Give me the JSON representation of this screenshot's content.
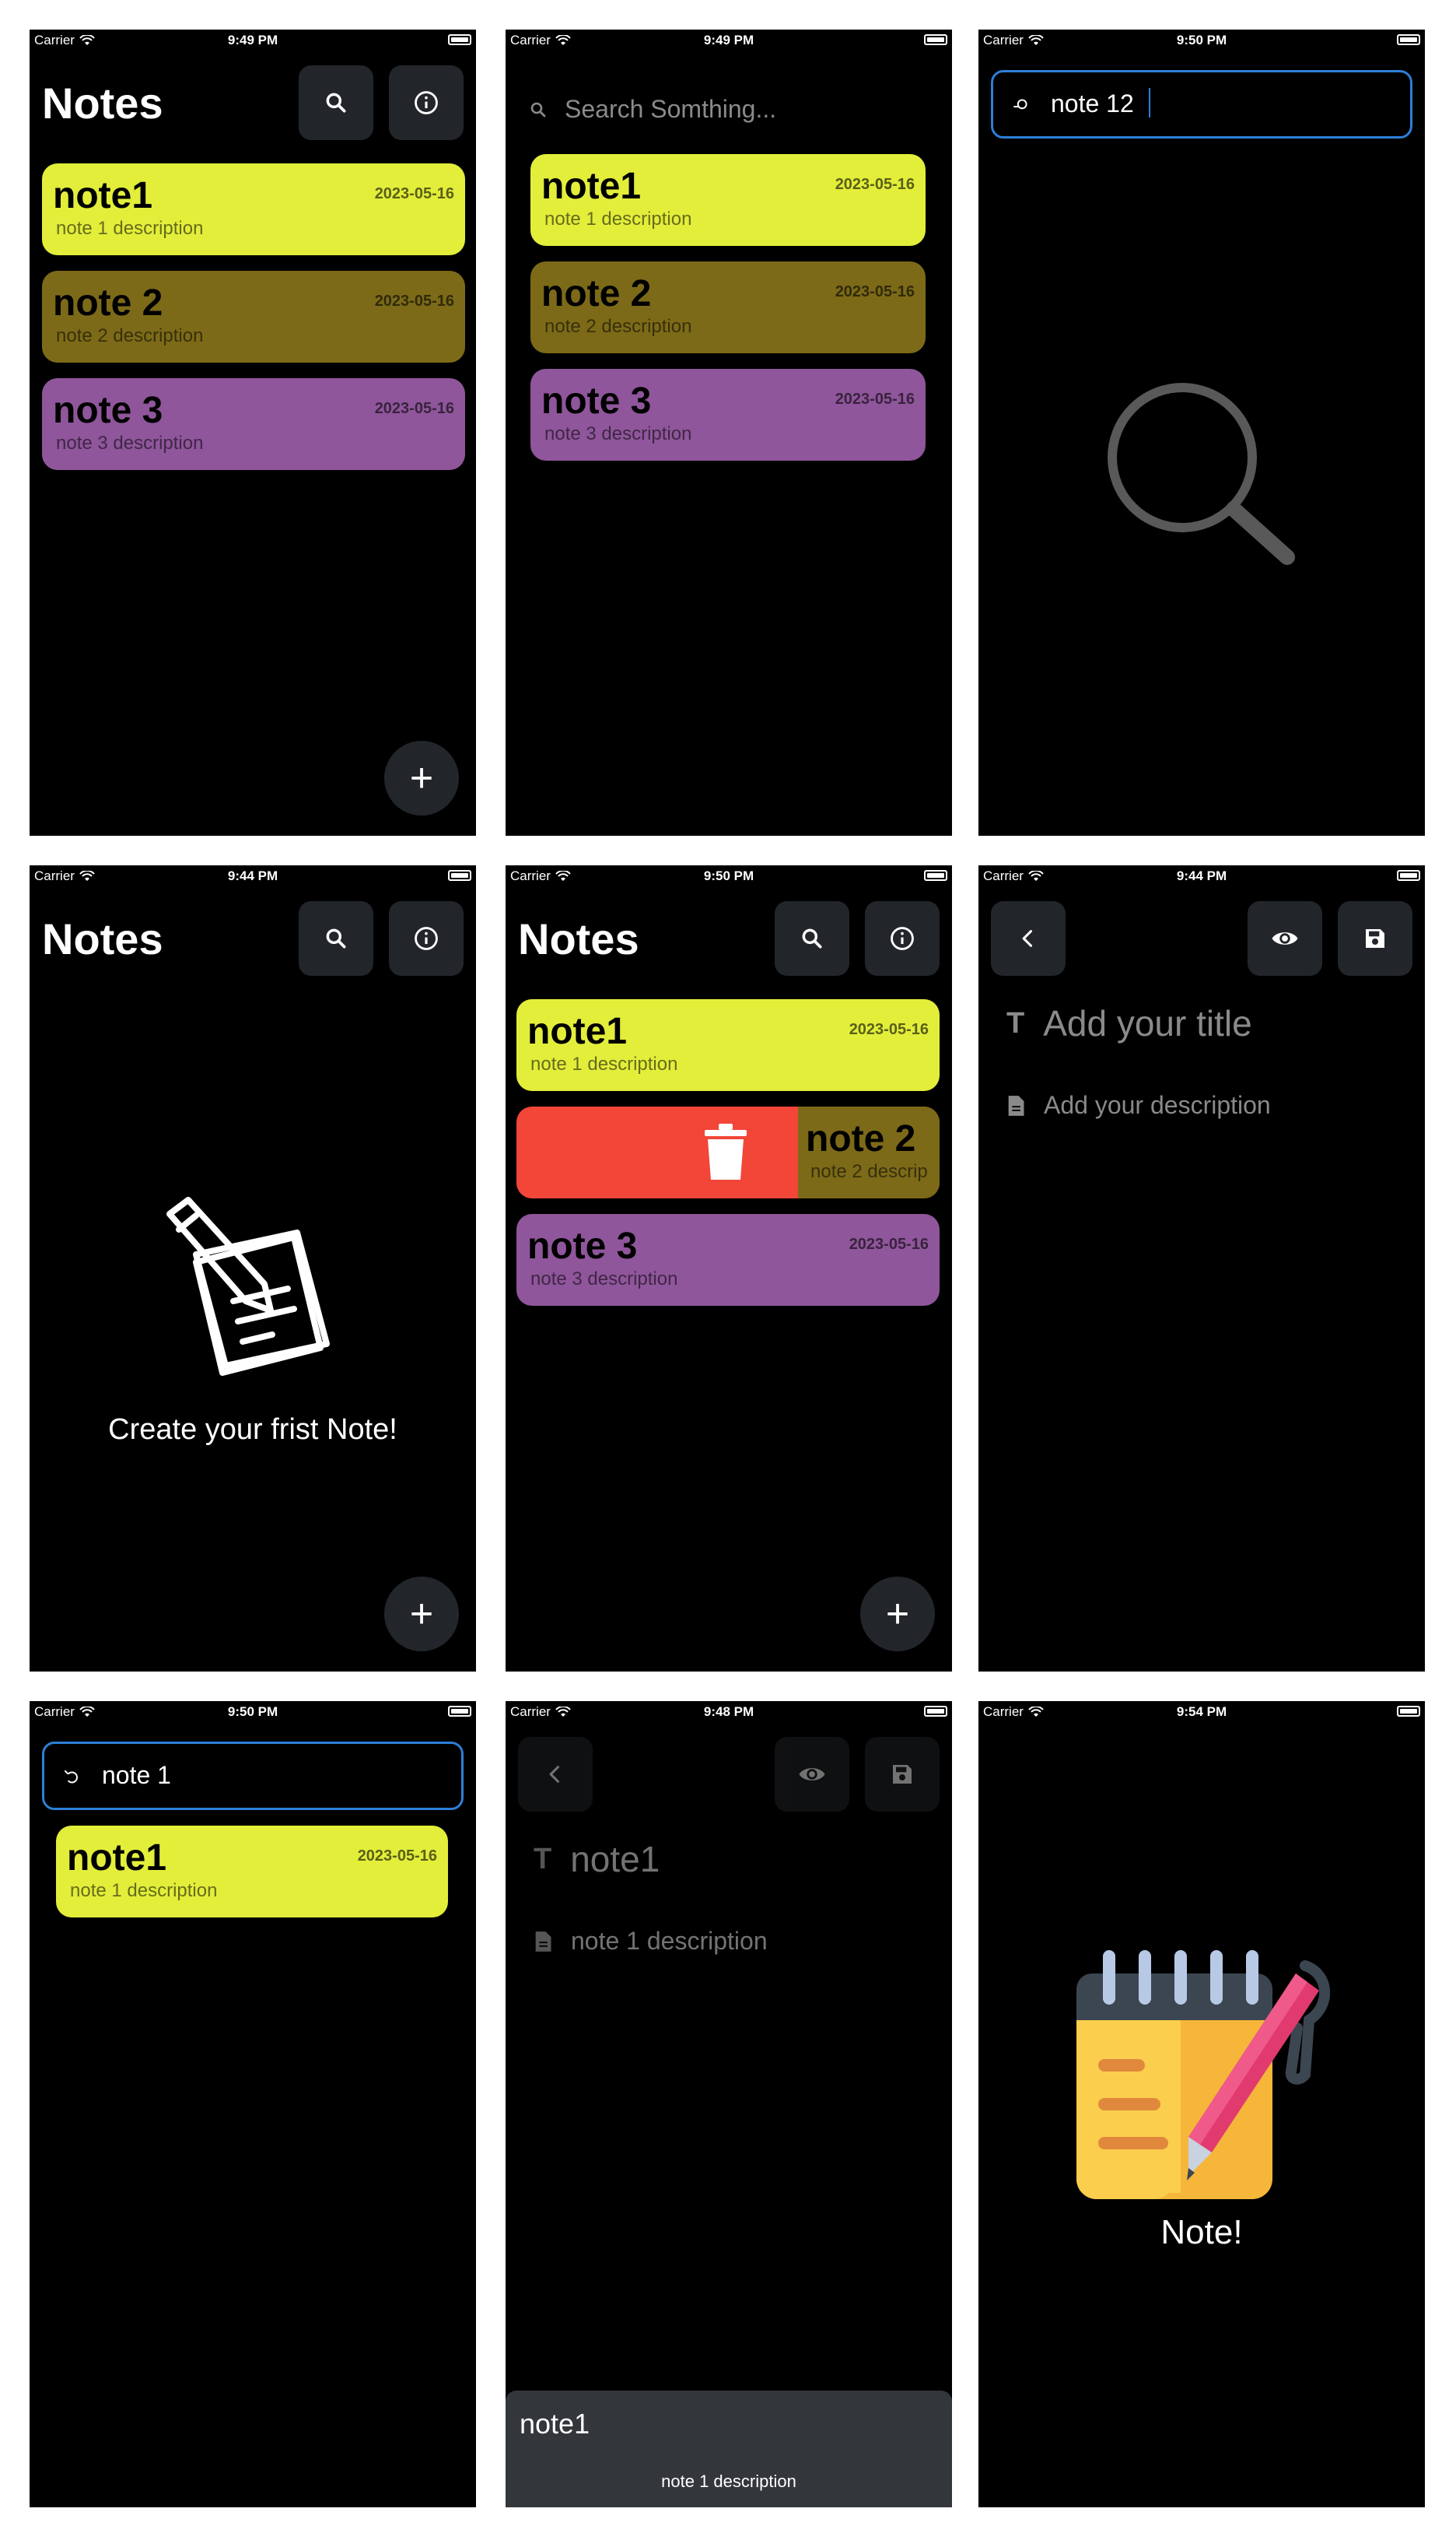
{
  "status": {
    "carrier": "Carrier",
    "times": [
      "9:49 PM",
      "9:49 PM",
      "9:50 PM",
      "9:44 PM",
      "9:50 PM",
      "9:44 PM",
      "9:50 PM",
      "9:48 PM",
      "9:54 PM"
    ]
  },
  "app": {
    "title": "Notes"
  },
  "notes": [
    {
      "title": "note1",
      "description": "note 1 description",
      "date": "2023-05-16",
      "color": "#e2ee3a"
    },
    {
      "title": "note 2",
      "description": "note 2 description",
      "date": "2023-05-16",
      "color": "#7c6a18"
    },
    {
      "title": "note 3",
      "description": "note 3 description",
      "date": "2023-05-16",
      "color": "#8f569b"
    }
  ],
  "search": {
    "placeholder": "Search Somthing...",
    "query_no_match": "note 12",
    "query_match": "note 1"
  },
  "empty": {
    "message": "Create your frist Note!"
  },
  "swipe": {
    "partial_title": "note 2",
    "partial_description": "note 2 descrip",
    "delete_color": "#f24638"
  },
  "editor": {
    "title_placeholder": "Add your title",
    "description_placeholder": "Add your description",
    "filled_title": "note1",
    "filled_description": "note 1 description"
  },
  "preview": {
    "title": "note1",
    "description": "note 1 description"
  },
  "splash": {
    "label": "Note!"
  },
  "icons": {
    "search": "search-icon",
    "info": "info-icon",
    "add": "plus-icon",
    "back": "chevron-left-icon",
    "preview": "eye-icon",
    "save": "save-icon",
    "delete": "trash-icon",
    "title_field": "text-icon",
    "description_field": "document-icon",
    "empty_state": "notes-pencil-icon",
    "splash": "notepad-icon"
  },
  "colors": {
    "background": "#000000",
    "button": "#222529",
    "focus_border": "#2d7fd8"
  }
}
